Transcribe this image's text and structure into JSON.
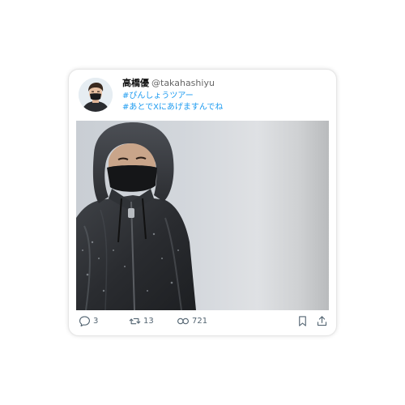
{
  "post": {
    "display_name": "高橋優",
    "handle": "@takahashiyu",
    "hashtags": [
      "#ぴんしょうツアー",
      "#あとでXにあげますんでね"
    ]
  },
  "actions": {
    "reply_count": "3",
    "repost_count": "13",
    "view_count": "721"
  },
  "icons": {
    "reply": "reply-icon",
    "repost": "repost-icon",
    "views": "views-icon",
    "bookmark": "bookmark-icon",
    "share": "share-icon"
  },
  "colors": {
    "hashtag": "#1d9bf0",
    "action": "#536471",
    "name": "#111111"
  }
}
